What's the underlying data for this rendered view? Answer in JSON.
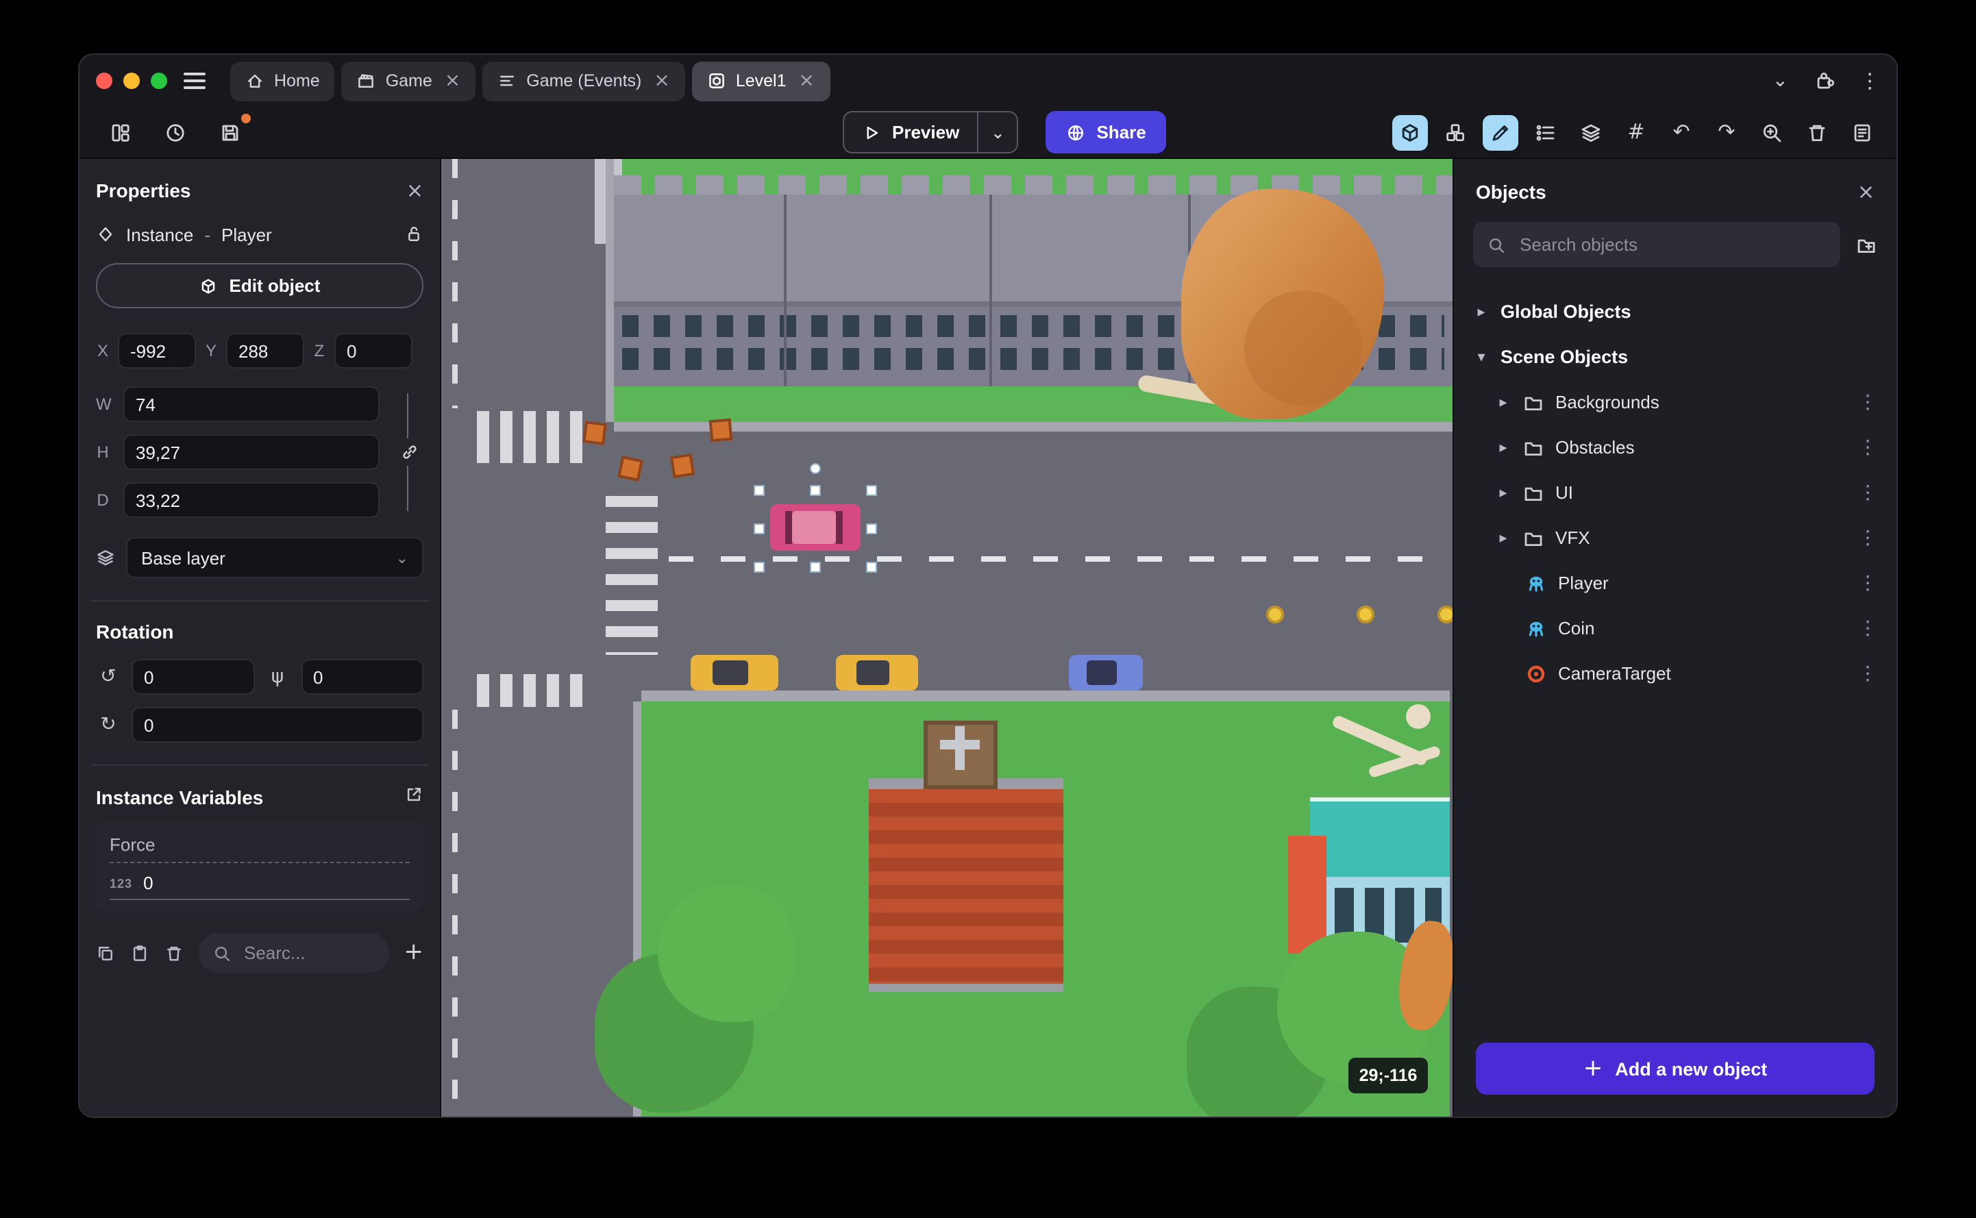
{
  "titlebar": {
    "tabs": [
      {
        "label": "Home",
        "closable": false,
        "active": false
      },
      {
        "label": "Game",
        "closable": true,
        "active": false
      },
      {
        "label": "Game (Events)",
        "closable": true,
        "active": false
      },
      {
        "label": "Level1",
        "closable": true,
        "active": true
      }
    ]
  },
  "toolbar": {
    "preview_label": "Preview",
    "share_label": "Share"
  },
  "properties": {
    "title": "Properties",
    "instance_label": "Instance",
    "separator": "-",
    "instance_name": "Player",
    "edit_object_label": "Edit object",
    "x_label": "X",
    "x_value": "-992",
    "y_label": "Y",
    "y_value": "288",
    "z_label": "Z",
    "z_value": "0",
    "w_label": "W",
    "w_value": "74",
    "h_label": "H",
    "h_value": "39,27",
    "d_label": "D",
    "d_value": "33,22",
    "layer_value": "Base layer",
    "rotation_title": "Rotation",
    "rot_x": "0",
    "rot_y": "0",
    "rot_z": "0",
    "variables_title": "Instance Variables",
    "variable_name": "Force",
    "variable_type_badge": "123",
    "variable_value": "0",
    "search_placeholder": "Searc..."
  },
  "canvas": {
    "cursor_coordinates": "29;-116"
  },
  "objects": {
    "title": "Objects",
    "search_placeholder": "Search objects",
    "global_group_label": "Global Objects",
    "scene_group_label": "Scene Objects",
    "folders": [
      {
        "label": "Backgrounds"
      },
      {
        "label": "Obstacles"
      },
      {
        "label": "UI"
      },
      {
        "label": "VFX"
      }
    ],
    "items": [
      {
        "label": "Player",
        "icon_color": "#49b9ec"
      },
      {
        "label": "Coin",
        "icon_color": "#49b9ec"
      },
      {
        "label": "CameraTarget",
        "icon_color": "#e4572e"
      }
    ],
    "add_button_label": "Add a new object"
  },
  "icons": {
    "close": "×",
    "kebab": "⋮",
    "chevron_right": "▸",
    "chevron_down": "▾",
    "chevron_small": "⌄",
    "undo": "↶",
    "redo": "↷",
    "grid": "#",
    "plus": "+",
    "rotate_x": "↺",
    "rotate_y": "ψ",
    "rotate_z": "↻"
  },
  "colors": {
    "traffic_red": "#ff5f57",
    "traffic_yellow": "#febc2e",
    "traffic_green": "#28c840",
    "tool_selected_bg": "#a7daf7",
    "share_button": "#4b42dd",
    "add_button": "#4a2bd6"
  }
}
